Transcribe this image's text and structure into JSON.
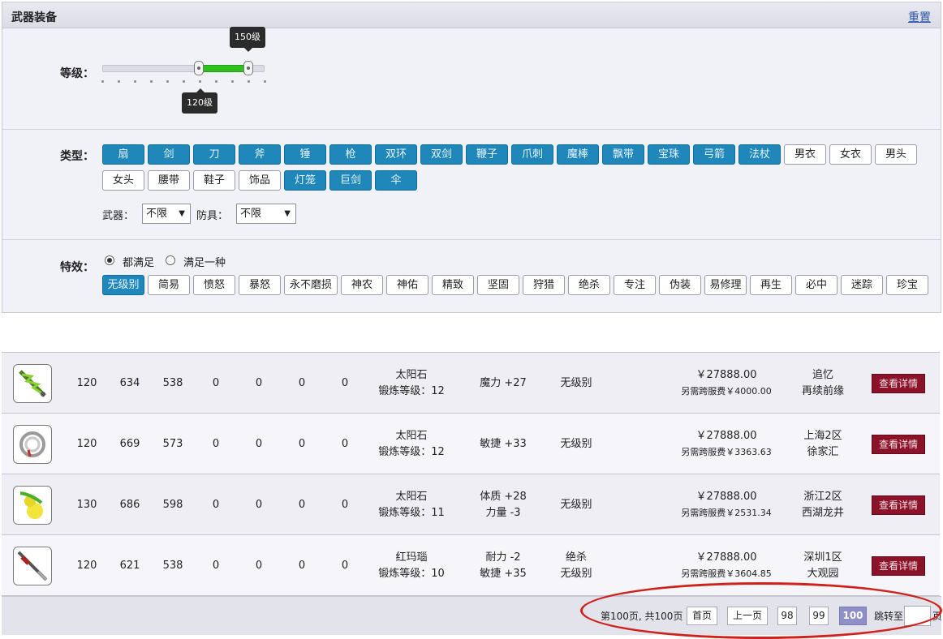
{
  "panel": {
    "title": "武器装备",
    "reset": "重置"
  },
  "level": {
    "label": "等级：",
    "min_tip": "120级",
    "max_tip": "150级",
    "range_min_level": 120,
    "range_max_level": 150
  },
  "types": {
    "label": "类型：",
    "items": [
      {
        "label": "扇",
        "on": true
      },
      {
        "label": "剑",
        "on": true
      },
      {
        "label": "刀",
        "on": true
      },
      {
        "label": "斧",
        "on": true
      },
      {
        "label": "锤",
        "on": true
      },
      {
        "label": "枪",
        "on": true
      },
      {
        "label": "双环",
        "on": true
      },
      {
        "label": "双剑",
        "on": true
      },
      {
        "label": "鞭子",
        "on": true
      },
      {
        "label": "爪刺",
        "on": true
      },
      {
        "label": "魔棒",
        "on": true
      },
      {
        "label": "飘带",
        "on": true
      },
      {
        "label": "宝珠",
        "on": true
      },
      {
        "label": "弓箭",
        "on": true
      },
      {
        "label": "法杖",
        "on": true
      },
      {
        "label": "男衣",
        "on": false
      },
      {
        "label": "女衣",
        "on": false
      },
      {
        "label": "男头",
        "on": false
      },
      {
        "label": "女头",
        "on": false
      },
      {
        "label": "腰带",
        "on": false
      },
      {
        "label": "鞋子",
        "on": false
      },
      {
        "label": "饰品",
        "on": false
      },
      {
        "label": "灯笼",
        "on": true
      },
      {
        "label": "巨剑",
        "on": true
      },
      {
        "label": "伞",
        "on": true
      }
    ],
    "weapon_label": "武器：",
    "weapon_value": "不限",
    "armor_label": "防具：",
    "armor_value": "不限"
  },
  "effects": {
    "label": "特效：",
    "radio_all": "都满足",
    "radio_any": "满足一种",
    "items": [
      {
        "label": "无级别",
        "on": true
      },
      {
        "label": "简易",
        "on": false
      },
      {
        "label": "愤怒",
        "on": false
      },
      {
        "label": "暴怒",
        "on": false
      },
      {
        "label": "永不磨损",
        "on": false
      },
      {
        "label": "神农",
        "on": false
      },
      {
        "label": "神佑",
        "on": false
      },
      {
        "label": "精致",
        "on": false
      },
      {
        "label": "坚固",
        "on": false
      },
      {
        "label": "狩猎",
        "on": false
      },
      {
        "label": "绝杀",
        "on": false
      },
      {
        "label": "专注",
        "on": false
      },
      {
        "label": "伪装",
        "on": false
      },
      {
        "label": "易修理",
        "on": false
      },
      {
        "label": "再生",
        "on": false
      },
      {
        "label": "必中",
        "on": false
      },
      {
        "label": "迷踪",
        "on": false
      },
      {
        "label": "珍宝",
        "on": false
      }
    ]
  },
  "listing": {
    "detail_label": "查看详情",
    "rows": [
      {
        "icon": "green-blade-icon",
        "level": "120",
        "c1": "634",
        "c2": "538",
        "c3": "0",
        "c4": "0",
        "c5": "0",
        "c6": "0",
        "gem": "太阳石",
        "forge": "锻炼等级：12",
        "attr1": "魔力 +27",
        "attr2": "",
        "effect1": "无级别",
        "effect2": "",
        "price": "￥27888.00",
        "fee": "另需跨服费￥4000.00",
        "server1": "追忆",
        "server2": "再续前缘"
      },
      {
        "icon": "ring-icon",
        "level": "120",
        "c1": "669",
        "c2": "573",
        "c3": "0",
        "c4": "0",
        "c5": "0",
        "c6": "0",
        "gem": "太阳石",
        "forge": "锻炼等级：12",
        "attr1": "敏捷 +33",
        "attr2": "",
        "effect1": "无级别",
        "effect2": "",
        "price": "￥27888.00",
        "fee": "另需跨服费￥3363.63",
        "server1": "上海2区",
        "server2": "徐家汇"
      },
      {
        "icon": "gourd-icon",
        "level": "130",
        "c1": "686",
        "c2": "598",
        "c3": "0",
        "c4": "0",
        "c5": "0",
        "c6": "0",
        "gem": "太阳石",
        "forge": "锻炼等级：11",
        "attr1": "体质 +28",
        "attr2": "力量 -3",
        "effect1": "无级别",
        "effect2": "",
        "price": "￥27888.00",
        "fee": "另需跨服费￥2531.34",
        "server1": "浙江2区",
        "server2": "西湖龙井"
      },
      {
        "icon": "spear-icon",
        "level": "120",
        "c1": "621",
        "c2": "538",
        "c3": "0",
        "c4": "0",
        "c5": "0",
        "c6": "0",
        "gem": "红玛瑙",
        "forge": "锻炼等级：10",
        "attr1": "耐力 -2",
        "attr2": "敏捷 +35",
        "effect1": "绝杀",
        "effect2": "无级别",
        "price": "￥27888.00",
        "fee": "另需跨服费￥3604.85",
        "server1": "深圳1区",
        "server2": "大观园"
      }
    ]
  },
  "pagination": {
    "summary": "第100页, 共100页",
    "first": "首页",
    "prev": "上一页",
    "p98": "98",
    "p99": "99",
    "p100": "100",
    "jump_to": "跳转至",
    "page_suffix": "页"
  },
  "colors": {
    "selected_button": "#1f87ba",
    "detail_button": "#8b1229",
    "slider_fill": "#2fbf1f",
    "annotation_ellipse": "#d0221c"
  }
}
